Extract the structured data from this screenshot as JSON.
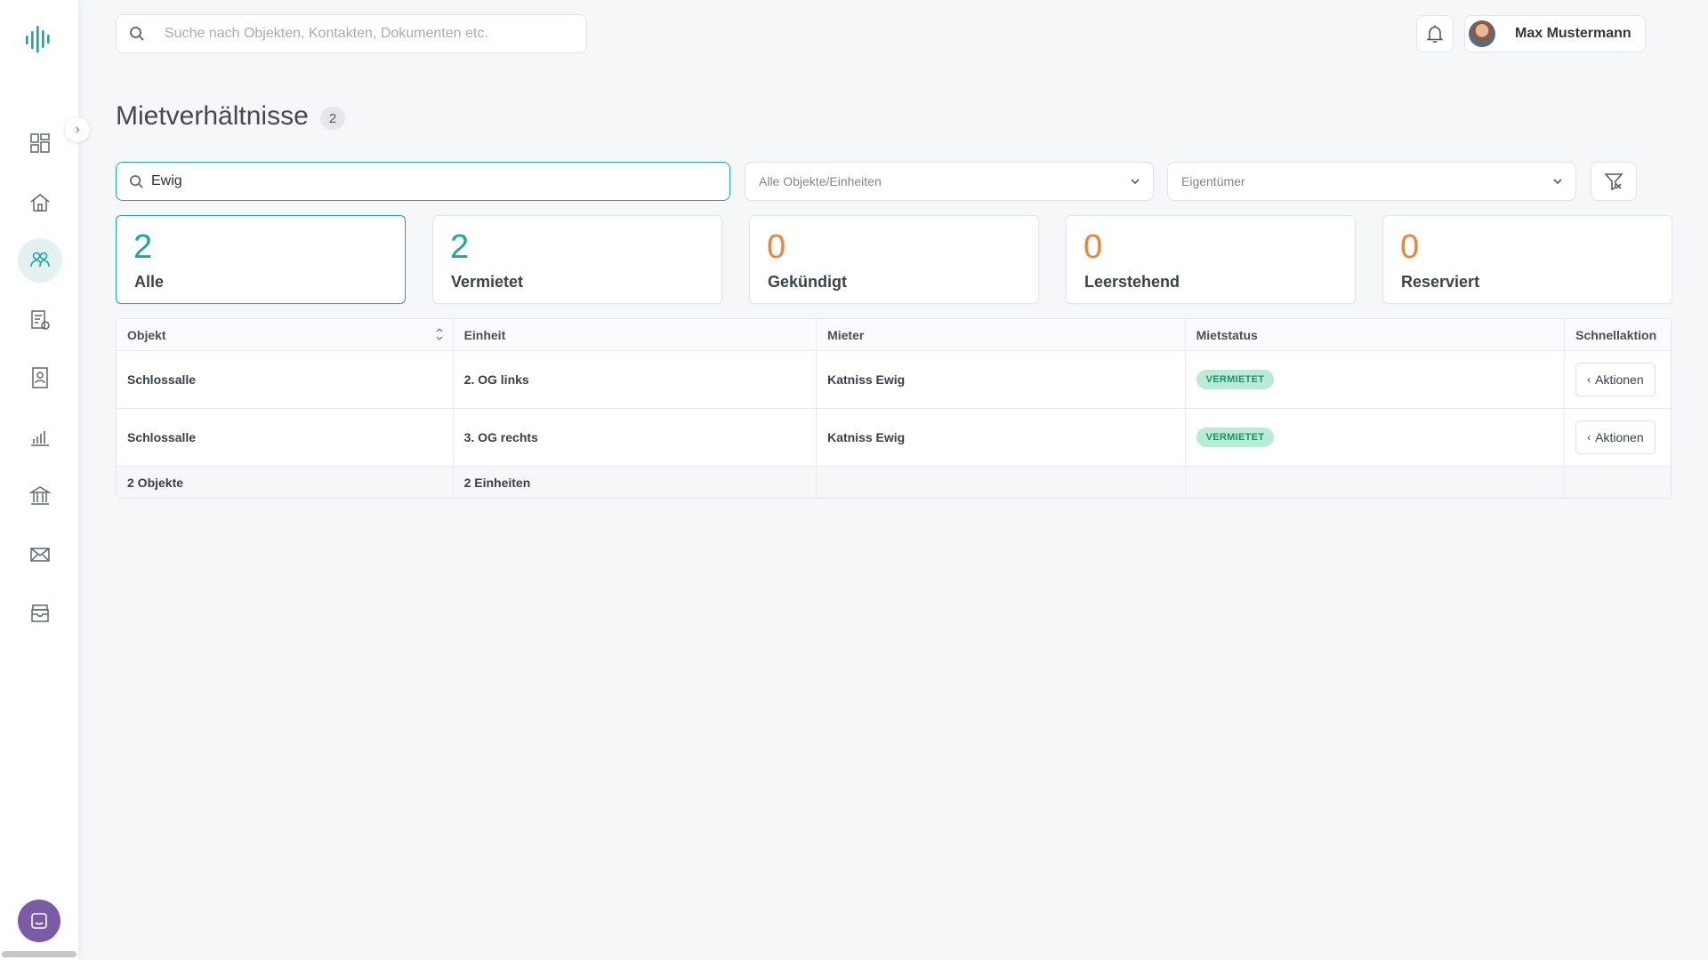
{
  "colors": {
    "accent": "#1aa7a0",
    "orange": "#e8853a",
    "badge_bg": "#b9ecd7",
    "badge_text": "#1f8f6a"
  },
  "sidebar": {
    "items": [
      {
        "name": "dashboard-icon"
      },
      {
        "name": "home-icon"
      },
      {
        "name": "tenants-icon",
        "active": true
      },
      {
        "name": "billing-icon"
      },
      {
        "name": "contacts-icon"
      },
      {
        "name": "analytics-icon"
      },
      {
        "name": "bank-icon"
      },
      {
        "name": "mail-icon"
      },
      {
        "name": "archive-icon"
      }
    ]
  },
  "header": {
    "search_placeholder": "Suche nach Objekten, Kontakten, Dokumenten etc.",
    "user_name": "Max Mustermann"
  },
  "page": {
    "title": "Mietverhältnisse",
    "count": "2"
  },
  "filters": {
    "search_value": "Ewig",
    "objects_select": "Alle Objekte/Einheiten",
    "owner_select": "Eigentümer"
  },
  "stats": [
    {
      "value": "2",
      "label": "Alle",
      "color": "#1aa7a0"
    },
    {
      "value": "2",
      "label": "Vermietet",
      "color": "#1aa7a0"
    },
    {
      "value": "0",
      "label": "Gekündigt",
      "color": "#e8853a"
    },
    {
      "value": "0",
      "label": "Leerstehend",
      "color": "#e8853a"
    },
    {
      "value": "0",
      "label": "Reserviert",
      "color": "#e8853a"
    }
  ],
  "table": {
    "headers": [
      "Objekt",
      "Einheit",
      "Mieter",
      "Mietstatus",
      "Schnellaktion"
    ],
    "rows": [
      {
        "objekt": "Schlossalle",
        "einheit": "2. OG links",
        "mieter": "Katniss Ewig",
        "status": "VERMIETET",
        "action": "Aktionen"
      },
      {
        "objekt": "Schlossalle",
        "einheit": "3. OG rechts",
        "mieter": "Katniss Ewig",
        "status": "VERMIETET",
        "action": "Aktionen"
      }
    ],
    "footer": {
      "objekte": "2 Objekte",
      "einheiten": "2 Einheiten"
    }
  }
}
